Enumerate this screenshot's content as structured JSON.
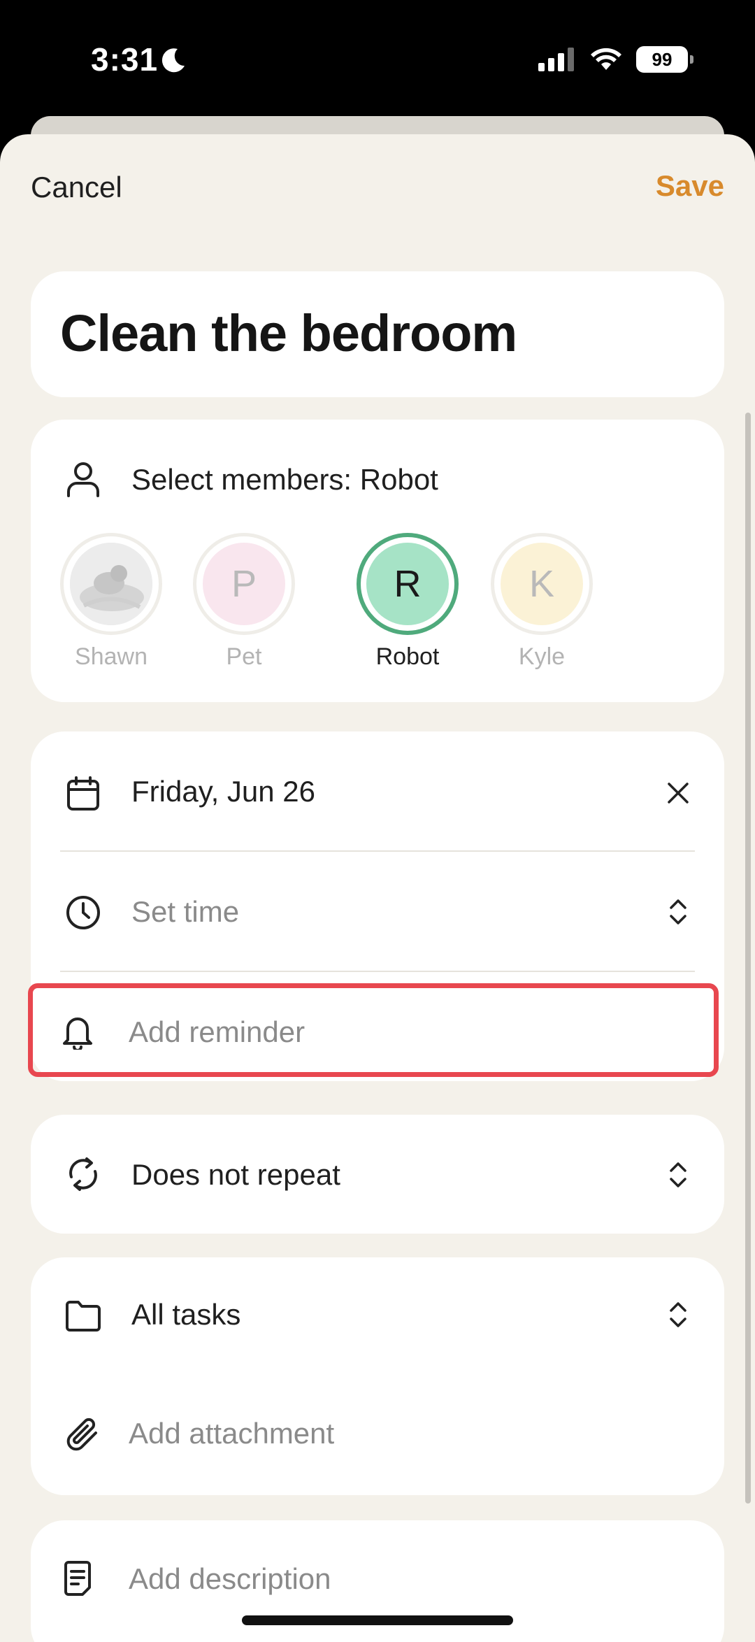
{
  "status_bar": {
    "time": "3:31",
    "battery": "99"
  },
  "header": {
    "cancel_label": "Cancel",
    "save_label": "Save"
  },
  "task": {
    "title": "Clean the bedroom"
  },
  "members": {
    "label": "Select members: Robot",
    "avatars": [
      {
        "initial": "",
        "name": "Shawn",
        "selected": false,
        "photo": true
      },
      {
        "initial": "P",
        "name": "Pet",
        "selected": false,
        "color": "#f9e6ee"
      },
      {
        "initial": "R",
        "name": "Robot",
        "selected": true,
        "color": "#a6e3c6"
      },
      {
        "initial": "K",
        "name": "Kyle",
        "selected": false,
        "color": "#fbf2d6"
      }
    ]
  },
  "schedule": {
    "date_label": "Friday, Jun 26",
    "time_placeholder": "Set time",
    "reminder_placeholder": "Add reminder"
  },
  "repeat": {
    "label": "Does not repeat"
  },
  "list": {
    "label": "All tasks",
    "attachment_placeholder": "Add attachment"
  },
  "description": {
    "placeholder": "Add description"
  },
  "colors": {
    "accent": "#d88a2c",
    "selected_ring": "#4faa7c",
    "highlight": "#e8474f",
    "background": "#f4f1ea"
  }
}
